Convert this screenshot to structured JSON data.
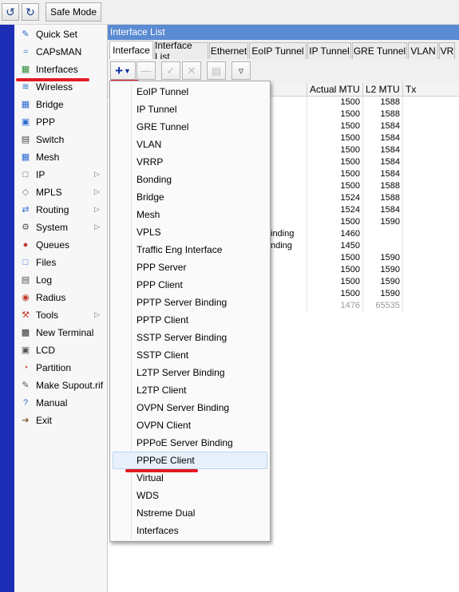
{
  "toolbar": {
    "undo_icon": "undo-icon",
    "redo_icon": "redo-icon",
    "safe_mode_label": "Safe Mode"
  },
  "side_menu": {
    "items": [
      {
        "label": "Quick Set",
        "icon": "quick-set-icon",
        "submenu": false
      },
      {
        "label": "CAPsMAN",
        "icon": "capsman-icon",
        "submenu": false
      },
      {
        "label": "Interfaces",
        "icon": "interfaces-icon",
        "submenu": false
      },
      {
        "label": "Wireless",
        "icon": "wireless-icon",
        "submenu": false
      },
      {
        "label": "Bridge",
        "icon": "bridge-icon",
        "submenu": false
      },
      {
        "label": "PPP",
        "icon": "ppp-icon",
        "submenu": false
      },
      {
        "label": "Switch",
        "icon": "switch-icon",
        "submenu": false
      },
      {
        "label": "Mesh",
        "icon": "mesh-icon",
        "submenu": false
      },
      {
        "label": "IP",
        "icon": "ip-icon",
        "submenu": true
      },
      {
        "label": "MPLS",
        "icon": "mpls-icon",
        "submenu": true
      },
      {
        "label": "Routing",
        "icon": "routing-icon",
        "submenu": true
      },
      {
        "label": "System",
        "icon": "system-icon",
        "submenu": true
      },
      {
        "label": "Queues",
        "icon": "queues-icon",
        "submenu": false
      },
      {
        "label": "Files",
        "icon": "files-icon",
        "submenu": false
      },
      {
        "label": "Log",
        "icon": "log-icon",
        "submenu": false
      },
      {
        "label": "Radius",
        "icon": "radius-icon",
        "submenu": false
      },
      {
        "label": "Tools",
        "icon": "tools-icon",
        "submenu": true
      },
      {
        "label": "New Terminal",
        "icon": "terminal-icon",
        "submenu": false
      },
      {
        "label": "LCD",
        "icon": "lcd-icon",
        "submenu": false
      },
      {
        "label": "Partition",
        "icon": "partition-icon",
        "submenu": false
      },
      {
        "label": "Make Supout.rif",
        "icon": "supout-icon",
        "submenu": false
      },
      {
        "label": "Manual",
        "icon": "manual-icon",
        "submenu": false
      },
      {
        "label": "Exit",
        "icon": "exit-icon",
        "submenu": false
      }
    ]
  },
  "window": {
    "title": "Interface List",
    "tabs": [
      "Interface",
      "Interface List",
      "Ethernet",
      "EoIP Tunnel",
      "IP Tunnel",
      "GRE Tunnel",
      "VLAN",
      "VR"
    ],
    "active_tab": "Interface",
    "toolbar_icons": [
      "add-icon",
      "remove-icon",
      "enable-icon",
      "disable-icon",
      "comment-icon",
      "filter-icon"
    ]
  },
  "table": {
    "headers": [
      "Actual MTU",
      "L2 MTU",
      "Tx"
    ],
    "rows": [
      {
        "type": "",
        "actual_mtu": "1500",
        "l2_mtu": "1588",
        "tx": "",
        "grey": false
      },
      {
        "type": "",
        "actual_mtu": "1500",
        "l2_mtu": "1588",
        "tx": "",
        "grey": false
      },
      {
        "type": "",
        "actual_mtu": "1500",
        "l2_mtu": "1584",
        "tx": "",
        "grey": false
      },
      {
        "type": "",
        "actual_mtu": "1500",
        "l2_mtu": "1584",
        "tx": "",
        "grey": false
      },
      {
        "type": "",
        "actual_mtu": "1500",
        "l2_mtu": "1584",
        "tx": "",
        "grey": false
      },
      {
        "type": "",
        "actual_mtu": "1500",
        "l2_mtu": "1584",
        "tx": "",
        "grey": false
      },
      {
        "type": "",
        "actual_mtu": "1500",
        "l2_mtu": "1584",
        "tx": "",
        "grey": false
      },
      {
        "type": "",
        "actual_mtu": "1500",
        "l2_mtu": "1588",
        "tx": "",
        "grey": false
      },
      {
        "type": "",
        "actual_mtu": "1524",
        "l2_mtu": "1588",
        "tx": "",
        "grey": false
      },
      {
        "type": "",
        "actual_mtu": "1524",
        "l2_mtu": "1584",
        "tx": "",
        "grey": false
      },
      {
        "type": "",
        "actual_mtu": "1500",
        "l2_mtu": "1590",
        "tx": "",
        "grey": false
      },
      {
        "type": "inding",
        "actual_mtu": "1460",
        "l2_mtu": "",
        "tx": "",
        "grey": false
      },
      {
        "type": "nding",
        "actual_mtu": "1450",
        "l2_mtu": "",
        "tx": "",
        "grey": false
      },
      {
        "type": "",
        "actual_mtu": "1500",
        "l2_mtu": "1590",
        "tx": "",
        "grey": false
      },
      {
        "type": "",
        "actual_mtu": "1500",
        "l2_mtu": "1590",
        "tx": "",
        "grey": false
      },
      {
        "type": "",
        "actual_mtu": "1500",
        "l2_mtu": "1590",
        "tx": "",
        "grey": false
      },
      {
        "type": "",
        "actual_mtu": "1500",
        "l2_mtu": "1590",
        "tx": "",
        "grey": false
      },
      {
        "type": "",
        "actual_mtu": "1476",
        "l2_mtu": "65535",
        "tx": "",
        "grey": true
      }
    ]
  },
  "add_menu": {
    "items": [
      "EoIP Tunnel",
      "IP Tunnel",
      "GRE Tunnel",
      "VLAN",
      "VRRP",
      "Bonding",
      "Bridge",
      "Mesh",
      "VPLS",
      "Traffic Eng Interface",
      "PPP Server",
      "PPP Client",
      "PPTP Server Binding",
      "PPTP Client",
      "SSTP Server Binding",
      "SSTP Client",
      "L2TP Server Binding",
      "L2TP Client",
      "OVPN Server Binding",
      "OVPN Client",
      "PPPoE Server Binding",
      "PPPoE Client",
      "Virtual",
      "WDS",
      "Nstreme Dual",
      "Interfaces"
    ],
    "highlighted": "PPPoE Client"
  },
  "colors": {
    "accent_red": "#e21b23",
    "title_blue": "#5b8bd2",
    "strip_blue": "#1c2db5"
  }
}
